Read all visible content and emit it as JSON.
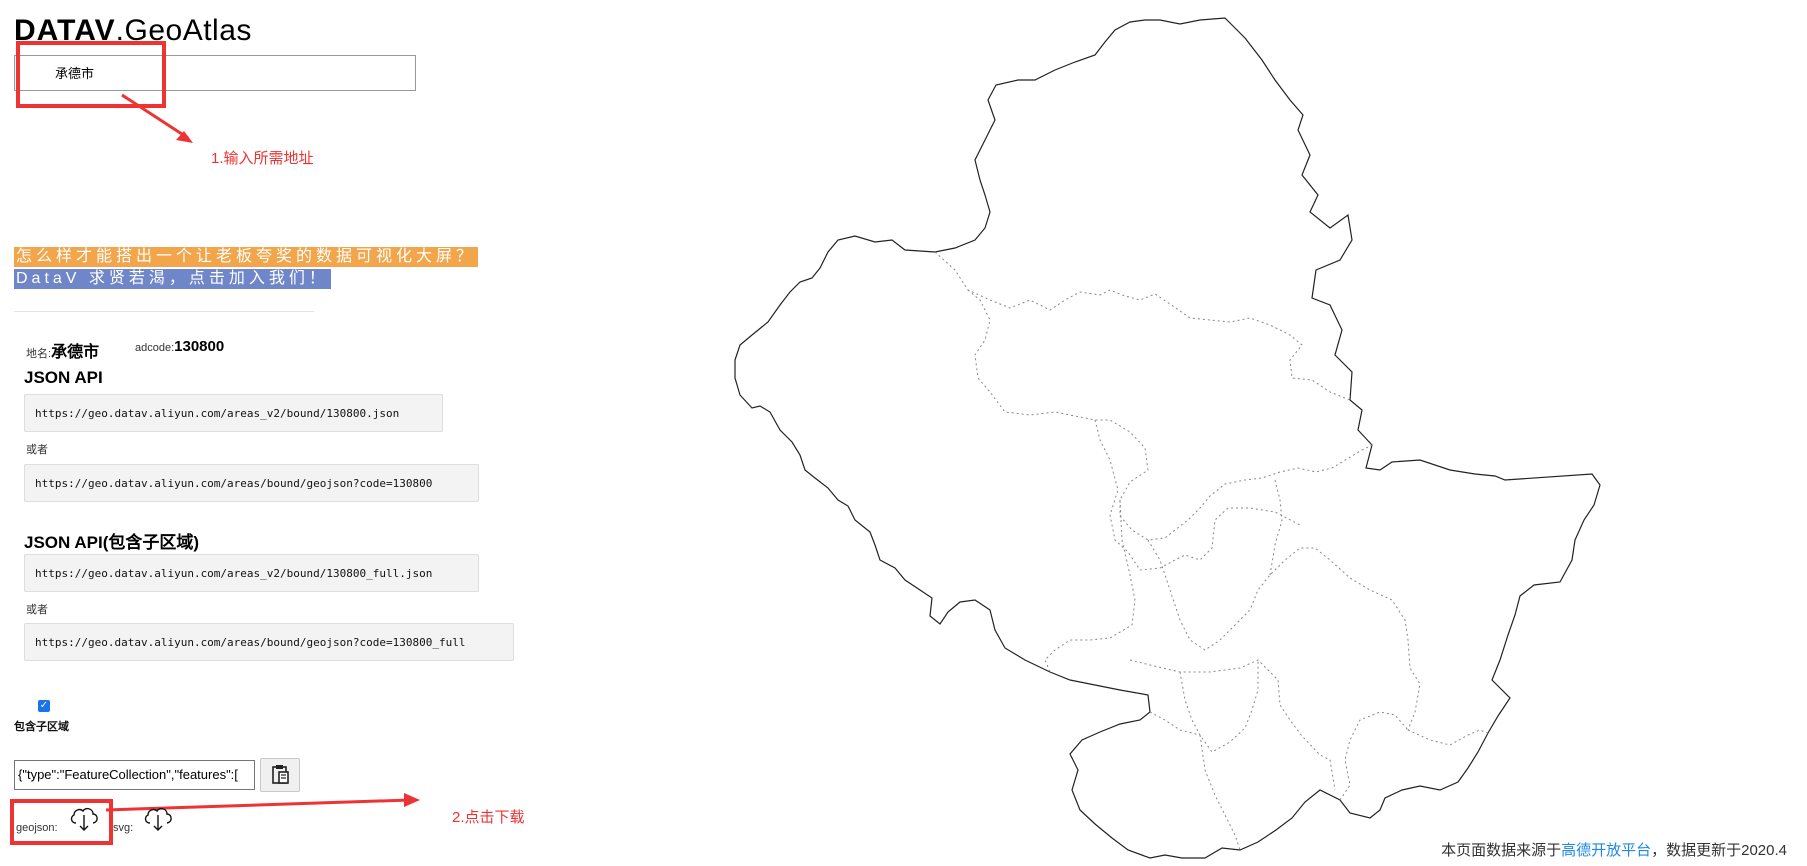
{
  "logo": {
    "brand": "DATAV",
    "rest": ".GeoAtlas"
  },
  "search": {
    "value": "承德市"
  },
  "annotations": {
    "step1": "1.输入所需地址",
    "step2": "2.点击下载"
  },
  "promo": {
    "line1": "怎么样才能搭出一个让老板夸奖的数据可视化大屏？",
    "line2": "DataV 求贤若渴，点击加入我们！"
  },
  "info": {
    "name_label": "地名:",
    "name_value": "承德市",
    "adcode_label": "adcode:",
    "adcode_value": "130800"
  },
  "api": {
    "title": "JSON API",
    "url1": "https://geo.datav.aliyun.com/areas_v2/bound/130800.json",
    "or1": "或者",
    "url2": "https://geo.datav.aliyun.com/areas/bound/geojson?code=130800",
    "title_full": "JSON API(包含子区域)",
    "url3": "https://geo.datav.aliyun.com/areas_v2/bound/130800_full.json",
    "or2": "或者",
    "url4": "https://geo.datav.aliyun.com/areas/bound/geojson?code=130800_full"
  },
  "options": {
    "include_sub_label": "包含子区域",
    "include_sub_checked": true
  },
  "output": {
    "json_preview": "{\"type\":\"FeatureCollection\",\"features\":["
  },
  "download": {
    "geojson_label": "geojson:",
    "svg_label": "svg:"
  },
  "footer": {
    "prefix": "本页面数据来源于",
    "link": "高德开放平台",
    "suffix": "，数据更新于2020.4"
  },
  "colors": {
    "accent_red": "#ee3333",
    "promo_orange": "#f2a54a",
    "promo_blue": "#6f86c9",
    "link_blue": "#1e88e5"
  }
}
